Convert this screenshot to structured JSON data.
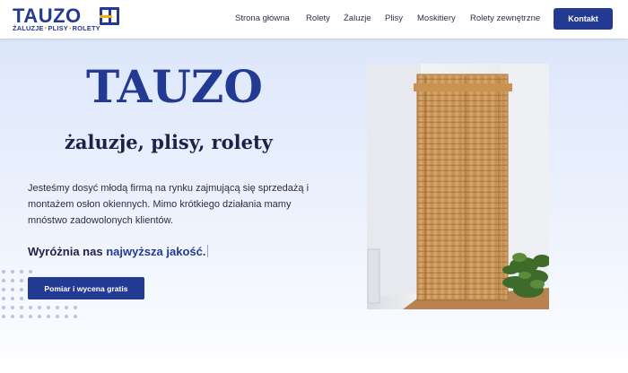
{
  "header": {
    "logo": {
      "title": "TAUZO",
      "sub": [
        "ŻALUZJE",
        "PLISY",
        "ROLETY"
      ]
    },
    "nav": [
      "Strona główna",
      "Rolety",
      "Żaluzje",
      "Plisy",
      "Moskitiery",
      "Rolety zewnętrzne"
    ],
    "contact_label": "Kontakt"
  },
  "hero": {
    "title": "TAUZO",
    "subtitle": "żaluzje, plisy, rolety",
    "description": "Jesteśmy dosyć młodą firmą na rynku zajmującą się sprzedażą i montażem osłon okiennych. Mimo krótkiego działania mamy mnóstwo zadowolonych klientów.",
    "highlight_prefix": "Wyróżnia nas ",
    "highlight_accent": "najwyższa jakość.",
    "cta_label": "Pomiar i wycena gratis"
  },
  "colors": {
    "brand": "#233a93",
    "accent": "#f1b40f",
    "hero_bg": "#e4ecfb"
  },
  "icons": {
    "logo_mark": "window-icon",
    "decoration": "dot-grid"
  }
}
